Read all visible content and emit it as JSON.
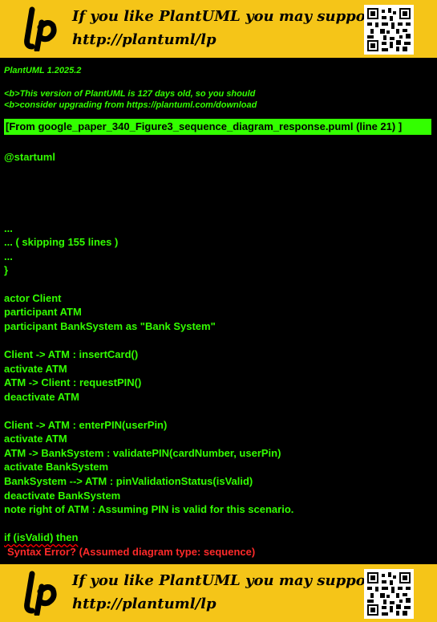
{
  "banner": {
    "line1": "If you like PlantUML you may support us!",
    "line2": "http://plantuml/lp",
    "logo_text": "lp"
  },
  "header": {
    "version": "PlantUML 1.2025.2",
    "notice1": "<b>This version of PlantUML is 127 days old, so you should",
    "notice2": "<b>consider upgrading from https://plantuml.com/download",
    "file_ref": "[From google_paper_340_Figure3_sequence_diagram_response.puml (line 21) ]"
  },
  "source": {
    "startuml": "@startuml",
    "dots1": "...",
    "skipping": "... ( skipping 155 lines )",
    "dots2": "...",
    "brace": "}",
    "l1": "actor Client",
    "l2": "participant ATM",
    "l3": "participant BankSystem as \"Bank System\"",
    "l4": "Client -> ATM : insertCard()",
    "l5": "activate ATM",
    "l6": "ATM -> Client : requestPIN()",
    "l7": "deactivate ATM",
    "l8": "Client -> ATM : enterPIN(userPin)",
    "l9": "activate ATM",
    "l10": "ATM -> BankSystem : validatePIN(cardNumber, userPin)",
    "l11": "activate BankSystem",
    "l12": "BankSystem --> ATM : pinValidationStatus(isValid)",
    "l13": "deactivate BankSystem",
    "l14": "note right of ATM : Assuming PIN is valid for this scenario.",
    "error_line": "if (isValid) then",
    "error_msg": "Syntax Error? (Assumed diagram type: sequence)"
  },
  "colors": {
    "banner_bg": "#f5c518",
    "text_green": "#33ff00",
    "error_red": "#ff2a2a",
    "background": "#000000"
  }
}
